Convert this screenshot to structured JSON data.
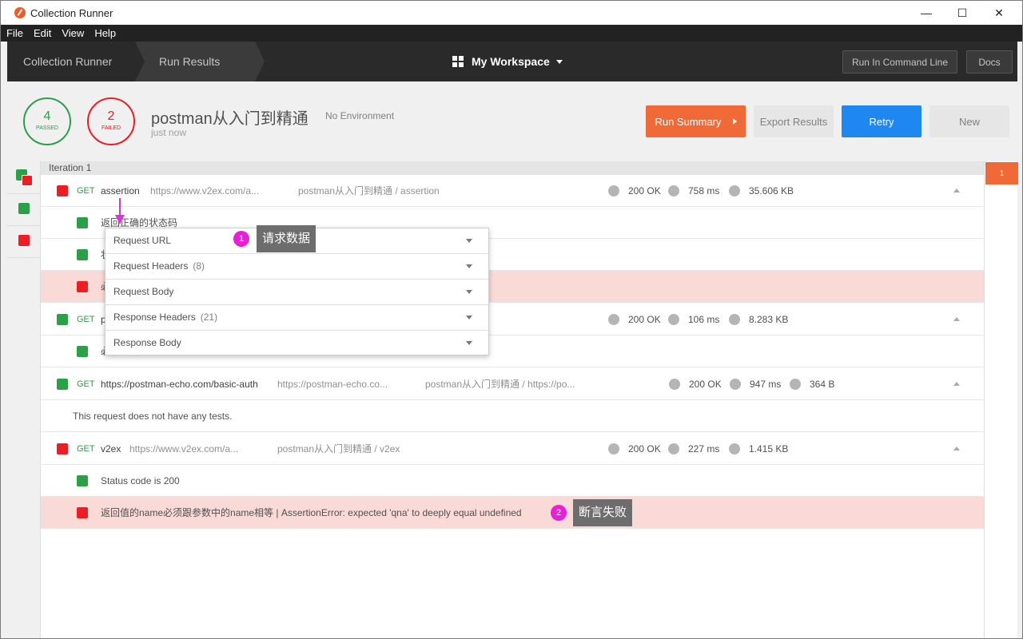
{
  "window": {
    "title": "Collection Runner",
    "minimize": "—",
    "maximize": "☐",
    "close": "✕"
  },
  "menu": [
    "File",
    "Edit",
    "View",
    "Help"
  ],
  "topbar": {
    "crumbs": [
      "Collection Runner",
      "Run Results"
    ],
    "workspace": "My Workspace",
    "run_cli": "Run In Command Line",
    "docs": "Docs"
  },
  "summary": {
    "passed_count": "4",
    "passed_label": "PASSED",
    "failed_count": "2",
    "failed_label": "FAILED",
    "collection": "postman从入门到精通",
    "environment": "No Environment",
    "time": "just now",
    "buttons": {
      "run_summary": "Run Summary",
      "export": "Export Results",
      "retry": "Retry",
      "new": "New"
    }
  },
  "iteration": {
    "label": "Iteration 1",
    "badge": "1"
  },
  "requests": [
    {
      "method": "GET",
      "name": "assertion",
      "url": "https://www.v2ex.com/a...",
      "path": "postman从入门到精通 / assertion",
      "status": "200 OK",
      "time": "758 ms",
      "size": "35.606 KB",
      "tests": [
        {
          "text": "返回正确的状态码"
        },
        {
          "text": "状"
        },
        {
          "text": "必"
        }
      ]
    },
    {
      "method": "GET",
      "name": "p",
      "url": "",
      "path": "",
      "status": "200 OK",
      "time": "106 ms",
      "size": "8.283 KB",
      "tests": [
        {
          "text": "必须包含 \"name\""
        }
      ]
    },
    {
      "method": "GET",
      "name": "https://postman-echo.com/basic-auth",
      "url": "https://postman-echo.co...",
      "path": "postman从入门到精通 / https://po...",
      "status": "200 OK",
      "time": "947 ms",
      "size": "364 B",
      "no_tests": "This request does not have any tests."
    },
    {
      "method": "GET",
      "name": "v2ex",
      "url": "https://www.v2ex.com/a...",
      "path": "postman从入门到精通 / v2ex",
      "status": "200 OK",
      "time": "227 ms",
      "size": "1.415 KB",
      "tests": [
        {
          "text": "Status code is 200"
        },
        {
          "text": "返回值的name必须跟参数中的name相等 | AssertionError: expected 'qna' to deeply equal undefined"
        }
      ]
    }
  ],
  "popup": [
    {
      "label": "Request URL",
      "count": ""
    },
    {
      "label": "Request Headers",
      "count": "(8)"
    },
    {
      "label": "Request Body",
      "count": ""
    },
    {
      "label": "Response Headers",
      "count": "(21)"
    },
    {
      "label": "Response Body",
      "count": ""
    }
  ],
  "annotations": [
    {
      "num": "1",
      "text": "请求数据"
    },
    {
      "num": "2",
      "text": "断言失败"
    }
  ],
  "colors": {
    "passed": "#2aa146",
    "failed": "#ed1d24",
    "run_summary": "#ef6a36",
    "retry": "#1e88f0",
    "annotation": "#e91ed8"
  }
}
